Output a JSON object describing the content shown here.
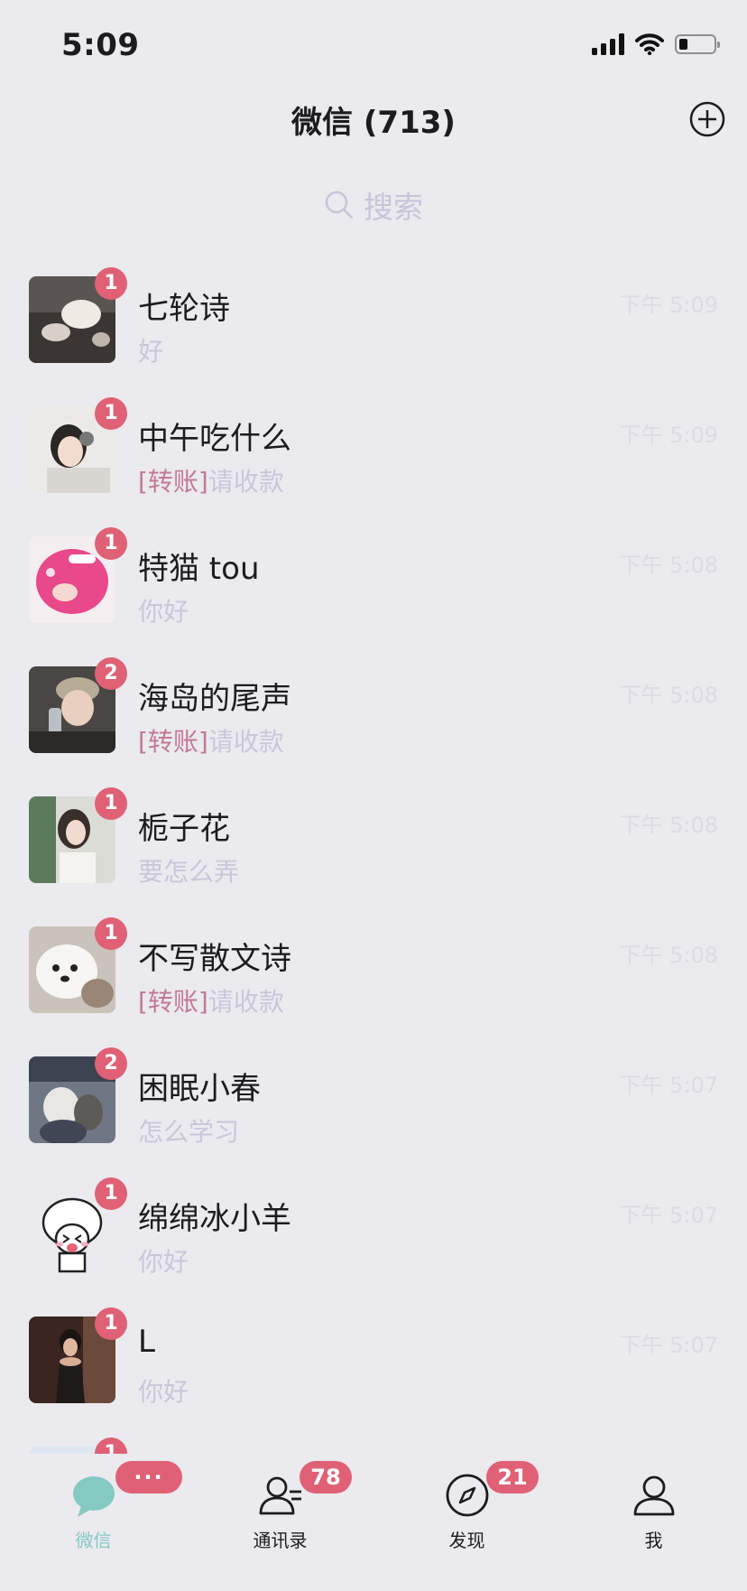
{
  "status_bar": {
    "time": "5:09"
  },
  "header": {
    "title": "微信 (713)"
  },
  "search": {
    "placeholder": "搜索"
  },
  "chats": [
    {
      "name": "七轮诗",
      "tag": "",
      "preview": "好",
      "badge": "1",
      "time": "下午 5:09"
    },
    {
      "name": "中午吃什么",
      "tag": "[转账]",
      "preview": "请收款",
      "badge": "1",
      "time": "下午 5:09"
    },
    {
      "name": "特猫 tou",
      "tag": "",
      "preview": "你好",
      "badge": "1",
      "time": "下午 5:08"
    },
    {
      "name": "海岛的尾声",
      "tag": "[转账]",
      "preview": "请收款",
      "badge": "2",
      "time": "下午 5:08"
    },
    {
      "name": "栀子花",
      "tag": "",
      "preview": "要怎么弄",
      "badge": "1",
      "time": "下午 5:08"
    },
    {
      "name": "不写散文诗",
      "tag": "[转账]",
      "preview": "请收款",
      "badge": "1",
      "time": "下午 5:08"
    },
    {
      "name": "困眠小春",
      "tag": "",
      "preview": "怎么学习",
      "badge": "2",
      "time": "下午 5:07"
    },
    {
      "name": "绵绵冰小羊",
      "tag": "",
      "preview": "你好",
      "badge": "1",
      "time": "下午 5:07"
    },
    {
      "name": "L",
      "tag": "",
      "preview": "你好",
      "badge": "1",
      "time": "下午 5:07"
    },
    {
      "name": "",
      "tag": "",
      "preview": "",
      "badge": "1",
      "time": ""
    }
  ],
  "tabbar": {
    "tabs": [
      {
        "label": "微信",
        "icon": "chat-bubble-icon",
        "badge": "···",
        "active": true
      },
      {
        "label": "通讯录",
        "icon": "contacts-icon",
        "badge": "78",
        "active": false
      },
      {
        "label": "发现",
        "icon": "compass-icon",
        "badge": "21",
        "active": false
      },
      {
        "label": "我",
        "icon": "person-icon",
        "badge": "",
        "active": false
      }
    ]
  },
  "colors": {
    "background": "#ebeaee",
    "badge": "#e06175",
    "active_tab": "#84c9c2",
    "preview_text": "#c9c7da",
    "transfer_tag": "#c27a92"
  }
}
